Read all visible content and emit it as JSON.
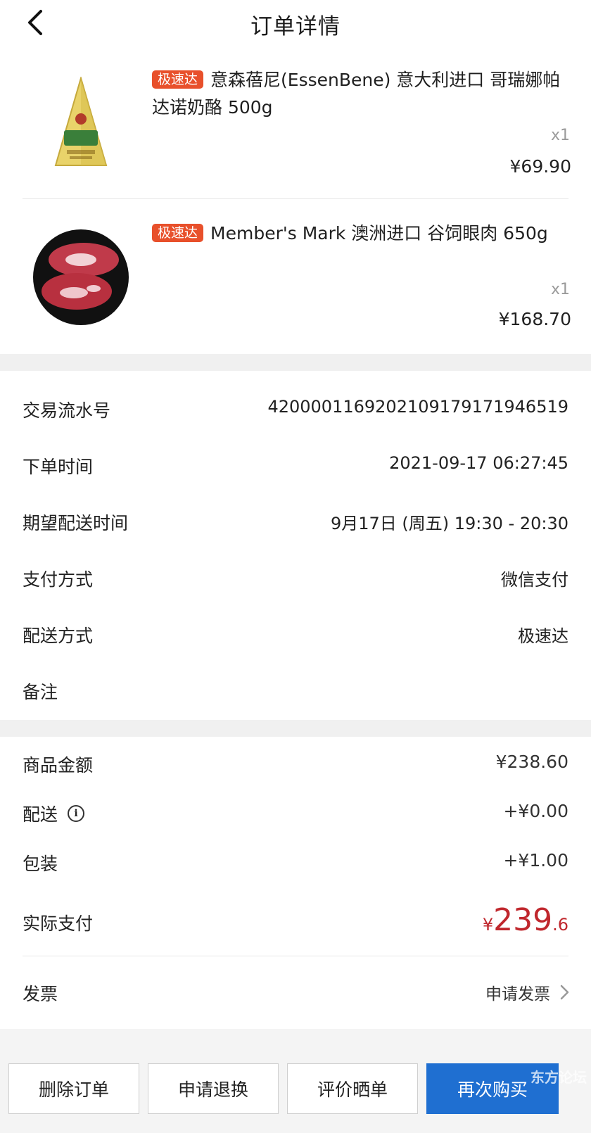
{
  "header": {
    "title": "订单详情"
  },
  "products": [
    {
      "tag": "极速达",
      "title": "意森蓓尼(EssenBene) 意大利进口 哥瑞娜帕达诺奶酪 500g",
      "qty": "x1",
      "price": "¥69.90",
      "image_icon": "cheese-wedge-image"
    },
    {
      "tag": "极速达",
      "title": "Member's Mark 澳洲进口 谷饲眼肉 650g",
      "qty": "x1",
      "price": "¥168.70",
      "image_icon": "steak-image"
    }
  ],
  "order_info": {
    "rows": [
      {
        "label": "交易流水号",
        "value": "4200001169202109179171946519"
      },
      {
        "label": "下单时间",
        "value": "2021-09-17 06:27:45"
      },
      {
        "label": "期望配送时间",
        "value": "9月17日 (周五) 19:30 - 20:30"
      },
      {
        "label": "支付方式",
        "value": "微信支付"
      },
      {
        "label": "配送方式",
        "value": "极速达"
      },
      {
        "label": "备注",
        "value": ""
      }
    ]
  },
  "amounts": {
    "goods_label": "商品金额",
    "goods_value": "¥238.60",
    "delivery_label": "配送",
    "delivery_value": "+¥0.00",
    "packaging_label": "包装",
    "packaging_value": "+¥1.00",
    "actual_label": "实际支付",
    "actual_currency": "¥",
    "actual_int": "239",
    "actual_dec": ".6"
  },
  "invoice": {
    "label": "发票",
    "action": "申请发票"
  },
  "actions": {
    "delete": "删除订单",
    "refund": "申请退换",
    "review": "评价晒单",
    "rebuy": "再次购买"
  },
  "watermark": "东方论坛",
  "colors": {
    "tag": "#e8502b",
    "accent_blue": "#1f6fd1",
    "pay_red": "#c0272d"
  }
}
